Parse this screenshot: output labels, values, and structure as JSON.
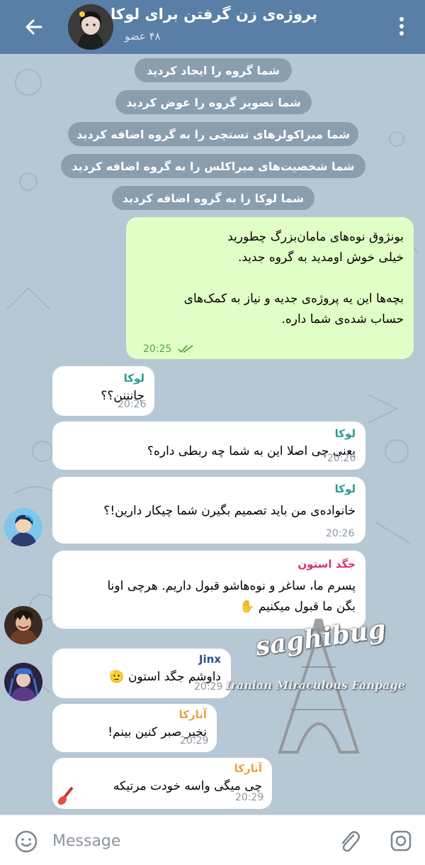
{
  "header": {
    "title": "پروژه‌ی زن گرفتن برای لوکا",
    "subtitle": "۴۸ عضو",
    "back_icon": "arrow-left-icon",
    "menu_icon": "more-vertical-icon"
  },
  "service_messages": [
    "شما گروه را ایجاد کردید",
    "شما تصویر گروه را عوض کردید",
    "شما میراکولرهای تستچی را به گروه اضافه کردید",
    "شما شخصیت‌های میراکلس را به گروه اضافه کردید",
    "شما لوکا را به گروه اضافه کردید"
  ],
  "outgoing": {
    "lines": [
      "بونژوق نوه‌های مامان‌بزرگ چطورید",
      "خیلی خوش اومدید به گروه جدید.",
      "",
      "بچه‌ها این یه پروژه‌ی جدیه و نیاز به کمک‌های",
      "حساب شده‌ی شما داره."
    ],
    "time": "20:25",
    "status_icon": "double-check-icon"
  },
  "messages": [
    {
      "author": "لوکا",
      "text": "جانننن؟؟",
      "time": "20:26",
      "author_color": "#2a9d8f"
    },
    {
      "author": "لوکا",
      "text": "یعنی چی اصلا این به شما چه ربطی داره؟",
      "time": "20:26",
      "author_color": "#2a9d8f"
    },
    {
      "author": "لوکا",
      "text": "خانواده‌ی من باید تصمیم بگیرن شما چیکار دارین!؟",
      "time": "20:26",
      "author_color": "#2a9d8f"
    },
    {
      "author": "جگد استون",
      "text_lines": [
        "پسرم ما، ساغر و نوه‌هاشو قبول داریم. هرچی اونا",
        "بگن ما قبول میکنیم"
      ],
      "emoji": "✋",
      "author_color": "#d6336c"
    },
    {
      "author": "Jinx",
      "text": "داوشم جگد استون",
      "emoji": "🫡",
      "time": "20:29",
      "author_color": "#2f4f8f"
    },
    {
      "author": "آنارکا",
      "text": "نخیر صبر کنین بینم!",
      "time": "20:29",
      "author_color": "#e6a23c"
    },
    {
      "author": "آنارکا",
      "text": "چی میگی واسه خودت مرتیکه",
      "time": "20:29",
      "author_color": "#e6a23c"
    }
  ],
  "watermark": {
    "brand": "saghibug",
    "caption": "Iranian Miraculous Fanpage"
  },
  "input": {
    "placeholder": "Message",
    "emoji_icon": "smile-icon",
    "attach_icon": "paperclip-icon",
    "camera_icon": "camera-icon"
  }
}
